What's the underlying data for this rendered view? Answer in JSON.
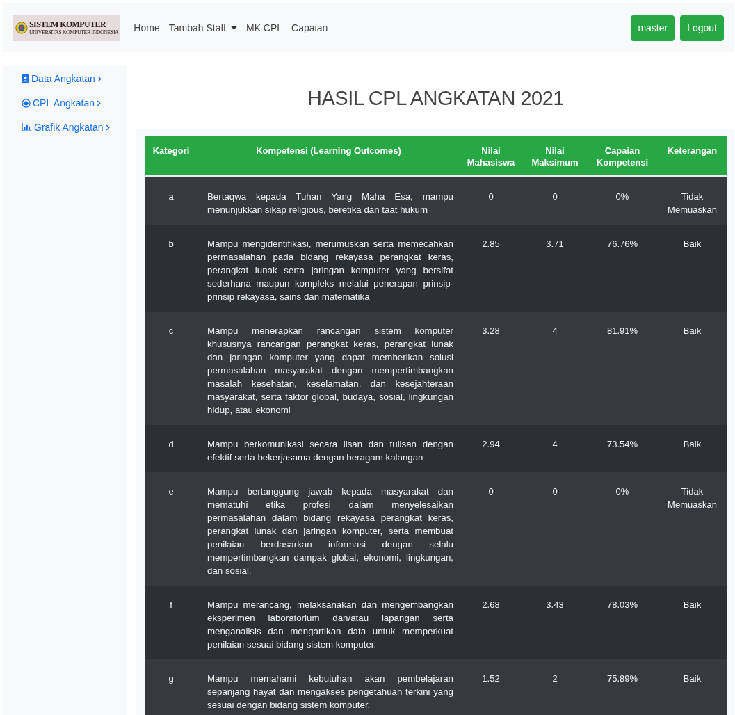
{
  "navbar": {
    "logo": {
      "title": "SISTEM KOMPUTER",
      "subtitle": "UNIVERSITAS KOMPUTER INDONESIA"
    },
    "links": [
      {
        "label": "Home",
        "dropdown": false
      },
      {
        "label": "Tambah Staff",
        "dropdown": true
      },
      {
        "label": "MK CPL",
        "dropdown": false
      },
      {
        "label": "Capaian",
        "dropdown": false
      }
    ],
    "buttons": [
      "master",
      "Logout"
    ]
  },
  "sidebar": {
    "items": [
      {
        "label": "Data Angkatan",
        "kind": "contact"
      },
      {
        "label": "CPL Angkatan",
        "kind": "gear"
      },
      {
        "label": "Grafik Angkatan",
        "kind": "chart"
      }
    ]
  },
  "page_title": "HASIL CPL ANGKATAN 2021",
  "table": {
    "columns": [
      "Kategori",
      "Kompetensi (Learning Outcomes)",
      "Nilai Mahasiswa",
      "Nilai Maksimum",
      "Capaian Kompetensi",
      "Keterangan"
    ],
    "rows": [
      {
        "kategori": "a",
        "kompetensi": "Bertaqwa kepada Tuhan Yang Maha Esa, mampu menunjukkan sikap religious, beretika dan taat hukum",
        "nilai_mahasiswa": "0",
        "nilai_maksimum": "0",
        "capaian": "0%",
        "keterangan": "Tidak Memuaskan"
      },
      {
        "kategori": "b",
        "kompetensi": "Mampu mengidentifikasi, merumuskan serta memecahkan permasalahan pada bidang rekayasa perangkat keras, perangkat lunak serta jaringan komputer yang bersifat sederhana maupun kompleks melalui penerapan prinsip-prinsip rekayasa, sains dan matematika",
        "nilai_mahasiswa": "2.85",
        "nilai_maksimum": "3.71",
        "capaian": "76.76%",
        "keterangan": "Baik"
      },
      {
        "kategori": "c",
        "kompetensi": "Mampu menerapkan rancangan sistem komputer khususnya rancangan perangkat keras, perangkat lunak dan jaringan komputer yang dapat memberikan solusi permasalahan masyarakat dengan mempertimbangkan masalah kesehatan, keselamatan, dan kesejahteraan masyarakat, serta faktor global, budaya, sosial, lingkungan hidup, atau ekonomi",
        "nilai_mahasiswa": "3.28",
        "nilai_maksimum": "4",
        "capaian": "81.91%",
        "keterangan": "Baik"
      },
      {
        "kategori": "d",
        "kompetensi": "Mampu berkomunikasi secara lisan dan tulisan dengan efektif serta bekerjasama dengan beragam kalangan",
        "nilai_mahasiswa": "2.94",
        "nilai_maksimum": "4",
        "capaian": "73.54%",
        "keterangan": "Baik"
      },
      {
        "kategori": "e",
        "kompetensi": "Mampu bertanggung jawab kepada masyarakat dan mematuhi etika profesi dalam menyelesaikan permasalahan dalam bidang rekayasa perangkat keras, perangkat lunak dan jaringan komputer, serta membuat penilaian berdasarkan informasi dengan selalu mempertimbangkan dampak global, ekonomi, lingkungan, dan sosial.",
        "nilai_mahasiswa": "0",
        "nilai_maksimum": "0",
        "capaian": "0%",
        "keterangan": "Tidak Memuaskan"
      },
      {
        "kategori": "f",
        "kompetensi": "Mampu merancang, melaksanakan dan mengembangkan eksperimen laboratorium dan/atau lapangan serta menganalisis dan mengartikan data untuk memperkuat penilaian sesuai bidang sistem komputer.",
        "nilai_mahasiswa": "2.68",
        "nilai_maksimum": "3.43",
        "capaian": "78.03%",
        "keterangan": "Baik"
      },
      {
        "kategori": "g",
        "kompetensi": "Mampu memahami kebutuhan akan pembelajaran sepanjang hayat dan mengakses pengetahuan terkini yang sesuai dengan bidang sistem komputer.",
        "nilai_mahasiswa": "1.52",
        "nilai_maksimum": "2",
        "capaian": "75.89%",
        "keterangan": "Baik"
      }
    ]
  }
}
